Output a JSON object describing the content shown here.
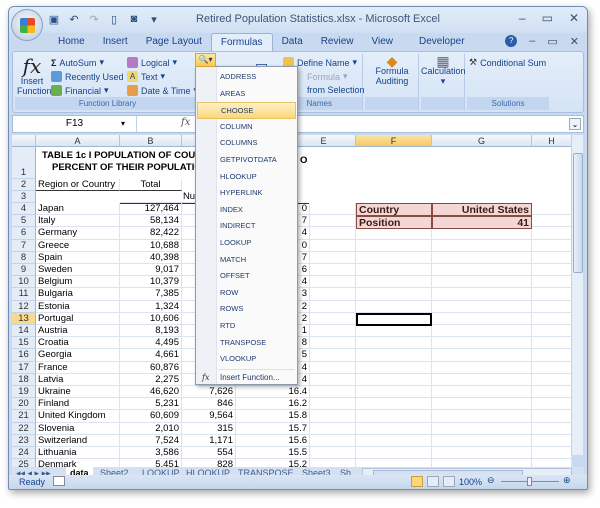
{
  "window": {
    "title": "Retired Population Statistics.xlsx - Microsoft Excel",
    "controls": [
      "minimize",
      "maximize",
      "close"
    ]
  },
  "qat": {
    "icons": [
      "save-icon",
      "undo-icon",
      "redo-icon",
      "new-icon",
      "camera-icon",
      "customize-icon"
    ]
  },
  "ribbon": {
    "tabs": [
      "Home",
      "Insert",
      "Page Layout",
      "Formulas",
      "Data",
      "Review",
      "View",
      "Developer"
    ],
    "active_tab": "Formulas",
    "function_library": {
      "label": "Function Library",
      "insert_function": "Insert Function",
      "autosum": "AutoSum",
      "recently_used": "Recently Used",
      "financial": "Financial",
      "logical": "Logical",
      "text": "Text",
      "date_time": "Date & Time"
    },
    "defined_names": {
      "label": "Names",
      "define_name": "Define Name",
      "use_in_formula": "Formula",
      "create_from_selection": "from Selection"
    },
    "formula_auditing": "Formula Auditing",
    "calculation": "Calculation",
    "solutions": {
      "label": "Solutions",
      "conditional_sum": "Conditional Sum"
    }
  },
  "formula_bar": {
    "name_box": "F13",
    "formula": ""
  },
  "lookup_menu": {
    "items": [
      "ADDRESS",
      "AREAS",
      "CHOOSE",
      "COLUMN",
      "COLUMNS",
      "GETPIVOTDATA",
      "HLOOKUP",
      "HYPERLINK",
      "INDEX",
      "INDIRECT",
      "LOOKUP",
      "MATCH",
      "OFFSET",
      "ROW",
      "ROWS",
      "RTD",
      "TRANSPOSE",
      "VLOOKUP"
    ],
    "highlighted": "CHOOSE",
    "insert_function": "Insert Function..."
  },
  "columns": [
    "A",
    "B",
    "C",
    "D",
    "E",
    "F",
    "G",
    "H"
  ],
  "selected_column": "F",
  "selected_row": 13,
  "sheet": {
    "title_line1": "TABLE 1c I POPULATION OF COUNTRIES WITH 15 OR MORE",
    "title_line1_visible": "TABLE 1c I POPULATION OF COUNTI",
    "title_line2_visible": "PERCENT OF THEIR POPULATION A",
    "title_tail_d": "O",
    "header_a2": "Region or Country",
    "header_b2": "Total",
    "header_b3": "Num",
    "rows": [
      {
        "n": 4,
        "country": "Japan",
        "total": "127,464",
        "c": "",
        "d": "0"
      },
      {
        "n": 5,
        "country": "Italy",
        "total": "58,134",
        "c": "",
        "d": "7"
      },
      {
        "n": 6,
        "country": "Germany",
        "total": "82,422",
        "c": "",
        "d": "4"
      },
      {
        "n": 7,
        "country": "Greece",
        "total": "10,688",
        "c": "",
        "d": "0"
      },
      {
        "n": 8,
        "country": "Spain",
        "total": "40,398",
        "c": "",
        "d": "7"
      },
      {
        "n": 9,
        "country": "Sweden",
        "total": "9,017",
        "c": "",
        "d": "6"
      },
      {
        "n": 10,
        "country": "Belgium",
        "total": "10,379",
        "c": "",
        "d": "4"
      },
      {
        "n": 11,
        "country": "Bulgaria",
        "total": "7,385",
        "c": "",
        "d": "3"
      },
      {
        "n": 12,
        "country": "Estonia",
        "total": "1,324",
        "c": "",
        "d": "2"
      },
      {
        "n": 13,
        "country": "Portugal",
        "total": "10,606",
        "c": "",
        "d": "2"
      },
      {
        "n": 14,
        "country": "Austria",
        "total": "8,193",
        "c": "",
        "d": "1"
      },
      {
        "n": 15,
        "country": "Croatia",
        "total": "4,495",
        "c": "",
        "d": "8"
      },
      {
        "n": 16,
        "country": "Georgia",
        "total": "4,661",
        "c": "",
        "d": "5"
      },
      {
        "n": 17,
        "country": "France",
        "total": "60,876",
        "c": "",
        "d": "4"
      },
      {
        "n": 18,
        "country": "Latvia",
        "total": "2,275",
        "c": "",
        "d": "4"
      },
      {
        "n": 19,
        "country": "Ukraine",
        "total": "46,620",
        "c": "7,626",
        "d": "16.4"
      },
      {
        "n": 20,
        "country": "Finland",
        "total": "5,231",
        "c": "846",
        "d": "16.2"
      },
      {
        "n": 21,
        "country": "United Kingdom",
        "total": "60,609",
        "c": "9,564",
        "d": "15.8"
      },
      {
        "n": 22,
        "country": "Slovenia",
        "total": "2,010",
        "c": "315",
        "d": "15.7"
      },
      {
        "n": 23,
        "country": "Switzerland",
        "total": "7,524",
        "c": "1,171",
        "d": "15.6"
      },
      {
        "n": 24,
        "country": "Lithuania",
        "total": "3,586",
        "c": "554",
        "d": "15.5"
      },
      {
        "n": 25,
        "country": "Denmark",
        "total": "5,451",
        "c": "828",
        "d": "15.2"
      }
    ],
    "lookup_box": {
      "country_label": "Country",
      "country_value": "United States",
      "position_label": "Position",
      "position_value": "41"
    }
  },
  "sheet_tabs": [
    "data",
    "Sheet2",
    "LOOKUP",
    "HLOOKUP",
    "TRANSPOSE",
    "Sheet3",
    "Sh"
  ],
  "active_sheet": "data",
  "status": {
    "text": "Ready",
    "zoom": "100%"
  }
}
